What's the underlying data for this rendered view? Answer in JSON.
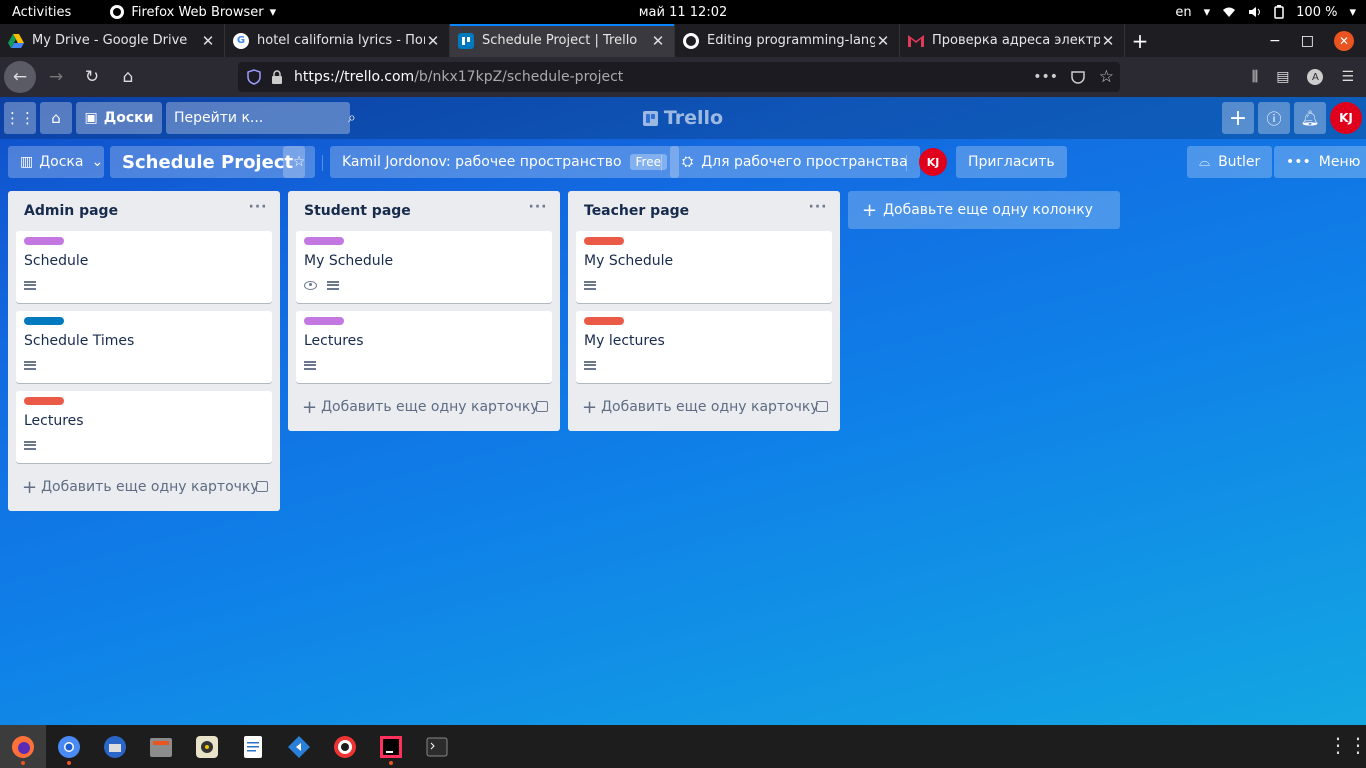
{
  "system": {
    "activities": "Activities",
    "app_name": "Firefox Web Browser",
    "clock": "май 11  12:02",
    "keyboard": "en",
    "battery": "100 %"
  },
  "browser": {
    "tabs": [
      {
        "title": "My Drive - Google Drive",
        "icon": "google-drive-icon"
      },
      {
        "title": "hotel california lyrics - Поиск",
        "icon": "google-icon"
      },
      {
        "title": "Schedule Project | Trello",
        "icon": "trello-icon",
        "active": true
      },
      {
        "title": "Editing programming-langua",
        "icon": "github-icon"
      },
      {
        "title": "Проверка адреса электрон",
        "icon": "gmail-icon"
      }
    ],
    "url_host": "https://trello.com",
    "url_path": "/b/nkx17kpZ/schedule-project"
  },
  "trello": {
    "boards_label": "Доски",
    "search_placeholder": "Перейти к...",
    "logo": "Trello",
    "user_initials": "KJ",
    "board": {
      "view_label": "Доска",
      "title": "Schedule Project",
      "workspace": "Kamil Jordonov: рабочее пространство",
      "plan_badge": "Free",
      "visibility": "Для рабочего пространства",
      "invite": "Пригласить",
      "butler": "Butler",
      "menu": "Меню"
    },
    "lists": [
      {
        "title": "Admin page",
        "cards": [
          {
            "title": "Schedule",
            "label_color": "#c377e0",
            "badges": [
              "description"
            ]
          },
          {
            "title": "Schedule Times",
            "label_color": "#0079bf",
            "badges": [
              "description"
            ]
          },
          {
            "title": "Lectures",
            "label_color": "#eb5a46",
            "badges": [
              "description"
            ]
          }
        ]
      },
      {
        "title": "Student page",
        "cards": [
          {
            "title": "My Schedule",
            "label_color": "#c377e0",
            "badges": [
              "watch",
              "description"
            ]
          },
          {
            "title": "Lectures",
            "label_color": "#c377e0",
            "badges": [
              "description"
            ]
          }
        ]
      },
      {
        "title": "Teacher page",
        "cards": [
          {
            "title": "My Schedule",
            "label_color": "#eb5a46",
            "badges": [
              "description"
            ]
          },
          {
            "title": "My lectures",
            "label_color": "#eb5a46",
            "badges": [
              "description"
            ]
          }
        ]
      }
    ],
    "add_card_label": "Добавить еще одну карточку",
    "add_list_label": "Добавьте еще одну колонку"
  },
  "dock": [
    "firefox-icon",
    "chromium-icon",
    "thunderbird-icon",
    "files-icon",
    "rhythmbox-icon",
    "libreoffice-writer-icon",
    "vscode-icon",
    "help-icon",
    "intellij-icon",
    "terminal-icon"
  ]
}
